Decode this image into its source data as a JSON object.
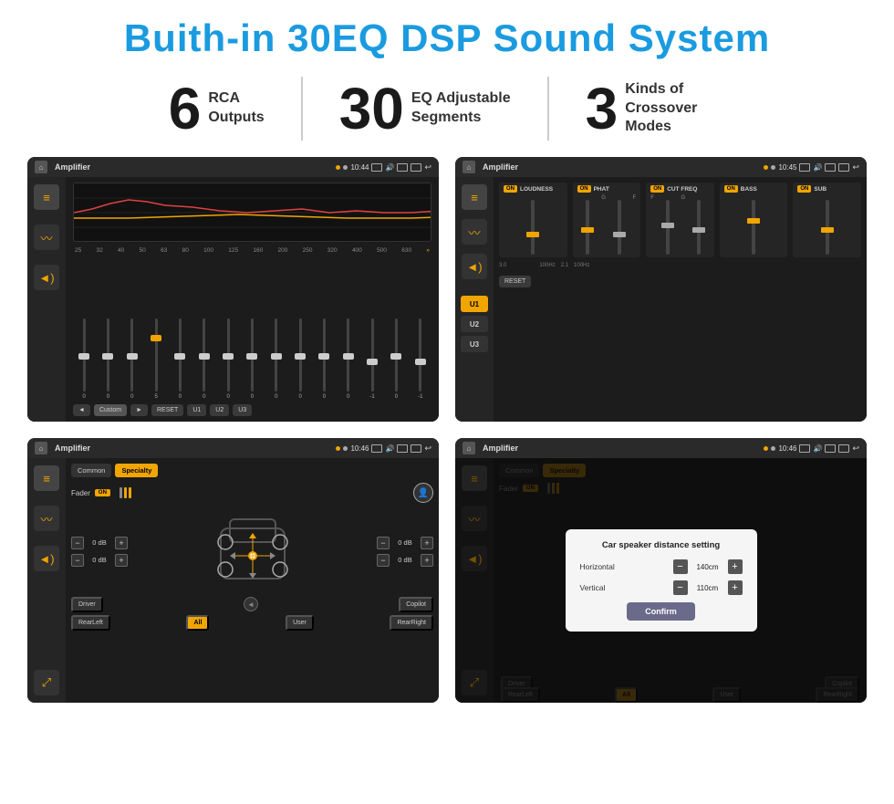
{
  "title": "Buith-in 30EQ DSP Sound System",
  "stats": [
    {
      "number": "6",
      "desc": "RCA\nOutputs"
    },
    {
      "number": "30",
      "desc": "EQ Adjustable\nSegments"
    },
    {
      "number": "3",
      "desc": "Kinds of\nCrossover Modes"
    }
  ],
  "screen1": {
    "statusBar": {
      "title": "Amplifier",
      "time": "10:44"
    },
    "eqLabels": [
      "25",
      "32",
      "40",
      "50",
      "63",
      "80",
      "100",
      "125",
      "160",
      "200",
      "250",
      "320",
      "400",
      "500",
      "630"
    ],
    "eqValues": [
      "0",
      "0",
      "0",
      "5",
      "0",
      "0",
      "0",
      "0",
      "0",
      "0",
      "0",
      "0",
      "-1",
      "0",
      "-1"
    ],
    "bottomButtons": [
      "Custom",
      "RESET",
      "U1",
      "U2",
      "U3"
    ]
  },
  "screen2": {
    "statusBar": {
      "title": "Amplifier",
      "time": "10:45"
    },
    "uButtons": [
      "U1",
      "U2",
      "U3"
    ],
    "modules": [
      {
        "name": "LOUDNESS",
        "on": true
      },
      {
        "name": "PHAT",
        "on": true
      },
      {
        "name": "CUT FREQ",
        "on": true
      },
      {
        "name": "BASS",
        "on": true
      },
      {
        "name": "SUB",
        "on": true
      }
    ],
    "resetBtn": "RESET"
  },
  "screen3": {
    "statusBar": {
      "title": "Amplifier",
      "time": "10:46"
    },
    "tabs": [
      "Common",
      "Specialty"
    ],
    "faderLabel": "Fader",
    "faderOn": "ON",
    "volumes": [
      {
        "label": "— 0 dB +",
        "top": true
      },
      {
        "label": "— 0 dB +",
        "bottom": false
      },
      {
        "label": "— 0 dB +",
        "right-top": true
      },
      {
        "label": "— 0 dB +",
        "right-bottom": false
      }
    ],
    "bottomButtons": [
      "Driver",
      "Copilot",
      "RearLeft",
      "All",
      "User",
      "RearRight"
    ]
  },
  "screen4": {
    "statusBar": {
      "title": "Amplifier",
      "time": "10:46"
    },
    "tabs": [
      "Common",
      "Specialty"
    ],
    "dialog": {
      "title": "Car speaker distance setting",
      "horizontal": {
        "label": "Horizontal",
        "value": "140cm"
      },
      "vertical": {
        "label": "Vertical",
        "value": "110cm"
      },
      "confirmBtn": "Confirm"
    },
    "bottomButtons": [
      "Driver",
      "Copilot",
      "RearLeft",
      "All",
      "User",
      "RearRight"
    ]
  }
}
